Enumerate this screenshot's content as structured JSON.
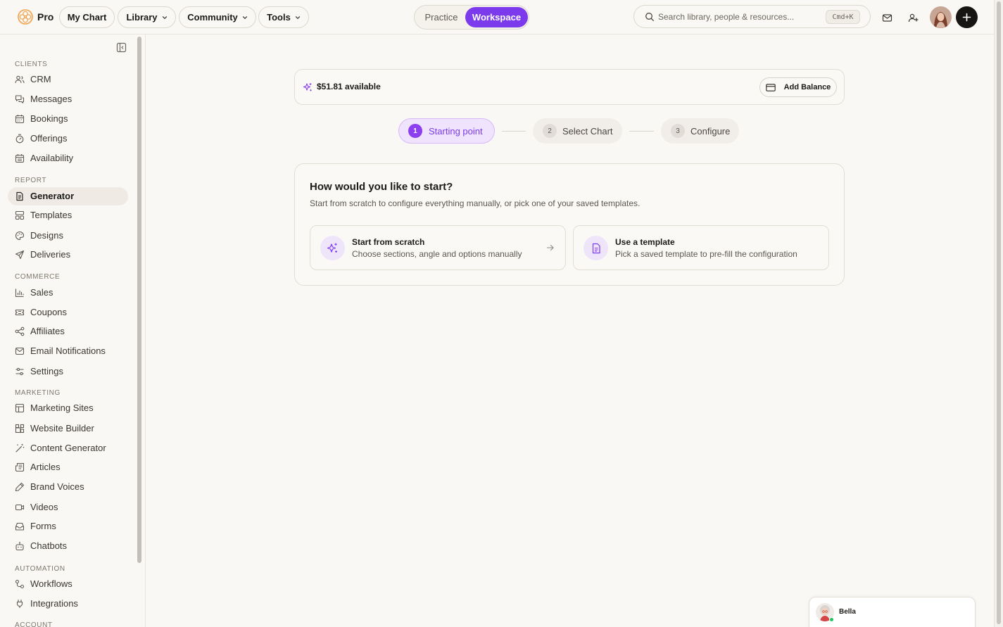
{
  "brand": {
    "name": "Pro"
  },
  "topnav": {
    "items": [
      {
        "label": "My Chart",
        "dropdown": false
      },
      {
        "label": "Library",
        "dropdown": true
      },
      {
        "label": "Community",
        "dropdown": true
      },
      {
        "label": "Tools",
        "dropdown": true
      }
    ],
    "mode_toggle": {
      "options": [
        "Practice",
        "Workspace"
      ],
      "selected": "Workspace"
    },
    "search": {
      "placeholder": "Search library, people & resources...",
      "shortcut": "Cmd+K"
    },
    "icons": [
      "mail-icon",
      "add-user-icon",
      "avatar",
      "plus-icon"
    ]
  },
  "sidebar": {
    "sections": [
      {
        "label": "CLIENTS",
        "items": [
          {
            "label": "CRM",
            "icon": "users-icon"
          },
          {
            "label": "Messages",
            "icon": "messages-icon"
          },
          {
            "label": "Bookings",
            "icon": "calendar-icon"
          },
          {
            "label": "Offerings",
            "icon": "timer-icon"
          },
          {
            "label": "Availability",
            "icon": "calendar-check-icon"
          }
        ]
      },
      {
        "label": "REPORT",
        "items": [
          {
            "label": "Generator",
            "icon": "file-text-icon",
            "active": true
          },
          {
            "label": "Templates",
            "icon": "layout-icon"
          },
          {
            "label": "Designs",
            "icon": "palette-icon"
          },
          {
            "label": "Deliveries",
            "icon": "send-icon"
          }
        ]
      },
      {
        "label": "COMMERCE",
        "items": [
          {
            "label": "Sales",
            "icon": "bar-chart-icon"
          },
          {
            "label": "Coupons",
            "icon": "ticket-icon"
          },
          {
            "label": "Affiliates",
            "icon": "share-icon"
          },
          {
            "label": "Email Notifications",
            "icon": "mail-icon"
          },
          {
            "label": "Settings",
            "icon": "sliders-icon"
          }
        ]
      },
      {
        "label": "MARKETING",
        "items": [
          {
            "label": "Marketing Sites",
            "icon": "browser-icon"
          },
          {
            "label": "Website Builder",
            "icon": "blocks-icon"
          },
          {
            "label": "Content Generator",
            "icon": "wand-icon"
          },
          {
            "label": "Articles",
            "icon": "newspaper-icon"
          },
          {
            "label": "Brand Voices",
            "icon": "pen-icon"
          },
          {
            "label": "Videos",
            "icon": "video-icon"
          },
          {
            "label": "Forms",
            "icon": "inbox-icon"
          },
          {
            "label": "Chatbots",
            "icon": "bot-icon"
          }
        ]
      },
      {
        "label": "AUTOMATION",
        "items": [
          {
            "label": "Workflows",
            "icon": "workflow-icon"
          },
          {
            "label": "Integrations",
            "icon": "plug-icon"
          }
        ]
      },
      {
        "label": "ACCOUNT",
        "items": []
      }
    ]
  },
  "balance": {
    "text": "$51.81 available",
    "button": "Add Balance"
  },
  "stepper": {
    "steps": [
      {
        "number": "1",
        "label": "Starting point",
        "active": true
      },
      {
        "number": "2",
        "label": "Select Chart",
        "active": false
      },
      {
        "number": "3",
        "label": "Configure",
        "active": false
      }
    ]
  },
  "start": {
    "title": "How would you like to start?",
    "subtitle": "Start from scratch to configure everything manually, or pick one of your saved templates.",
    "options": [
      {
        "title": "Start from scratch",
        "description": "Choose sections, angle and options manually",
        "icon": "sparkles-icon"
      },
      {
        "title": "Use a template",
        "description": "Pick a saved template to pre-fill the configuration",
        "icon": "document-icon"
      }
    ]
  },
  "chat": {
    "name": "Bella"
  },
  "colors": {
    "accent": "#7c3aed",
    "background": "#faf8f4",
    "border": "#e2ddd5",
    "online": "#22c55e"
  }
}
